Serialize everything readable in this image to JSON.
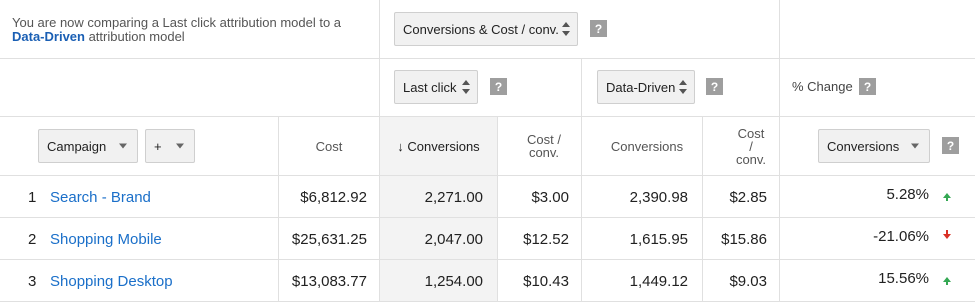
{
  "intro": {
    "text_line1": "You are now comparing a Last click attribution model to a",
    "model_link": "Data-Driven",
    "text_line2": " attribution model"
  },
  "metric_selector": {
    "value": "Conversions & Cost / conv.",
    "help": "?"
  },
  "models": {
    "baseline": {
      "value": "Last click",
      "help": "?"
    },
    "comparison": {
      "value": "Data-Driven",
      "help": "?"
    },
    "change_label": "% Change",
    "change_help": "?"
  },
  "controls": {
    "primary_dimension": "Campaign",
    "add_dimension": "+",
    "change_metric": "Conversions",
    "change_metric_help": "?"
  },
  "columns": {
    "cost": "Cost",
    "sort_arrow": "↓",
    "conversions_lc": "Conversions",
    "cpa_lc": "Cost / conv.",
    "conversions_dd": "Conversions",
    "cpa_dd_l1": "Cost",
    "cpa_dd_l2": "/",
    "cpa_dd_l3": "conv."
  },
  "rows": [
    {
      "index": "1",
      "campaign": "Search - Brand",
      "cost": "$6,812.92",
      "conv_lc": "2,271.00",
      "cpa_lc": "$3.00",
      "conv_dd": "2,390.98",
      "cpa_dd": "$2.85",
      "change": "5.28%",
      "direction": "up"
    },
    {
      "index": "2",
      "campaign": "Shopping Mobile",
      "cost": "$25,631.25",
      "conv_lc": "2,047.00",
      "cpa_lc": "$12.52",
      "conv_dd": "1,615.95",
      "cpa_dd": "$15.86",
      "change": "-21.06%",
      "direction": "down"
    },
    {
      "index": "3",
      "campaign": "Shopping Desktop",
      "cost": "$13,083.77",
      "conv_lc": "1,254.00",
      "cpa_lc": "$10.43",
      "conv_dd": "1,449.12",
      "cpa_dd": "$9.03",
      "change": "15.56%",
      "direction": "up"
    }
  ],
  "colors": {
    "link": "#1a6fc9",
    "up": "#34a853",
    "down": "#d93025",
    "shade": "#f3f3f3"
  }
}
